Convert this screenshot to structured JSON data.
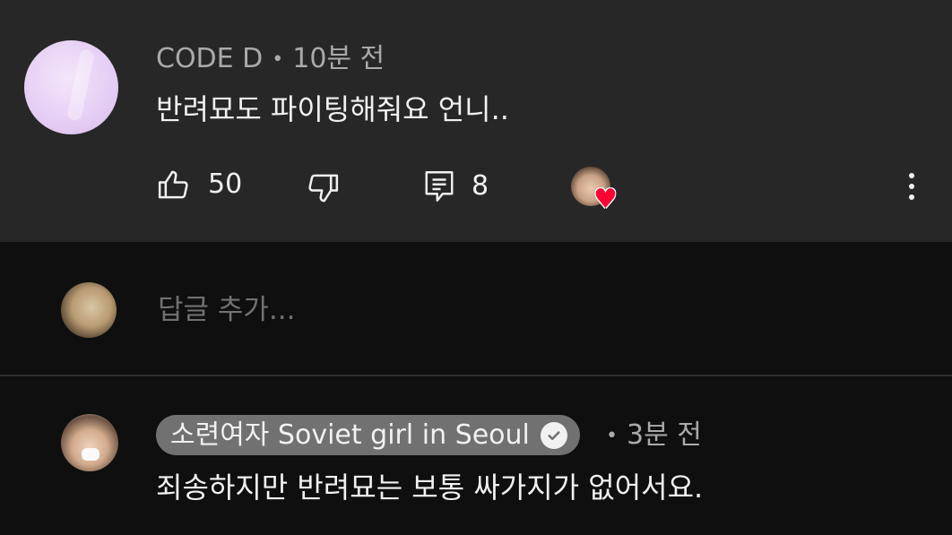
{
  "comment": {
    "author": "CODE D",
    "time": "10분 전",
    "text": "반려묘도 파이팅해줘요 언니..",
    "like_count": "50",
    "reply_count": "8",
    "icons": {
      "like": "thumbs-up-icon",
      "dislike": "thumbs-down-icon",
      "reply": "comment-icon",
      "creator_heart": "heart-icon",
      "more": "more-vert-icon"
    },
    "heart_color": "#ff0033"
  },
  "reply_box": {
    "placeholder": "답글 추가..."
  },
  "reply": {
    "author": "소련여자 Soviet girl in Seoul",
    "verified_icon": "verified-check-icon",
    "time": "3분 전",
    "text": "죄송하지만 반려묘는 보통 싸가지가 없어서요."
  },
  "separator": "•",
  "colors": {
    "background": "#0f0f0f",
    "highlighted_comment_bg": "#272727",
    "author_pill_bg": "#717171",
    "secondary_text": "#aaaaaa"
  }
}
